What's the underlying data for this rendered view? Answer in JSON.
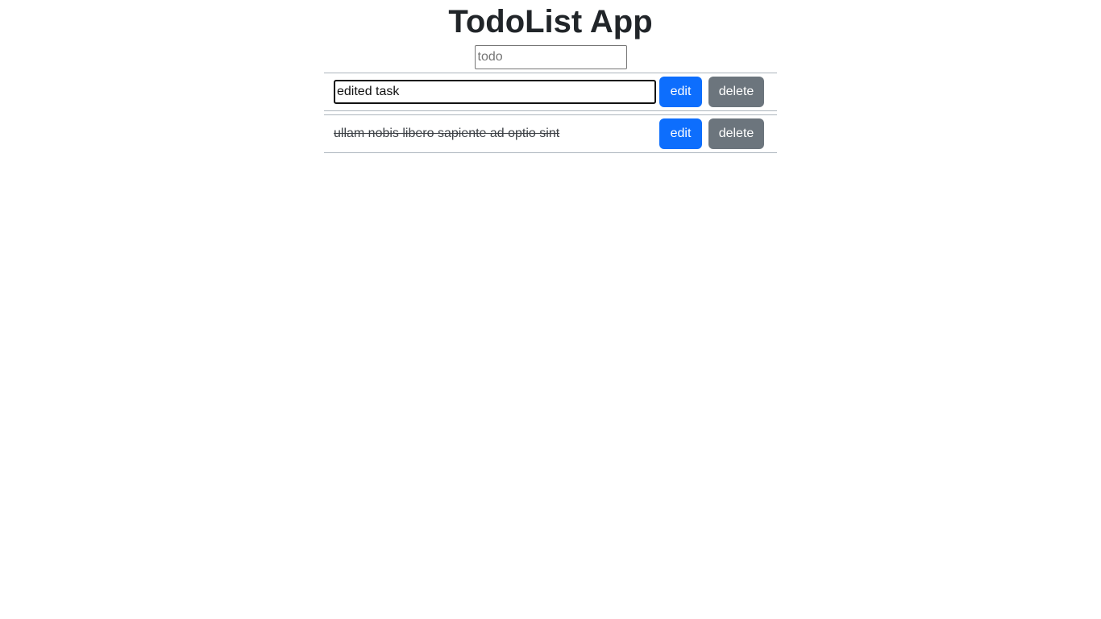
{
  "app": {
    "title": "TodoList App"
  },
  "new_todo": {
    "placeholder": "todo",
    "value": ""
  },
  "todos": [
    {
      "editing": true,
      "edit_value": "edited task",
      "edit_label": "edit",
      "delete_label": "delete"
    },
    {
      "text": "ullam nobis libero sapiente ad optio sint",
      "completed": true,
      "edit_label": "edit",
      "delete_label": "delete"
    }
  ],
  "colors": {
    "edit_button": "#0d6efd",
    "delete_button": "#6c757d",
    "divider": "#adb5bd"
  }
}
